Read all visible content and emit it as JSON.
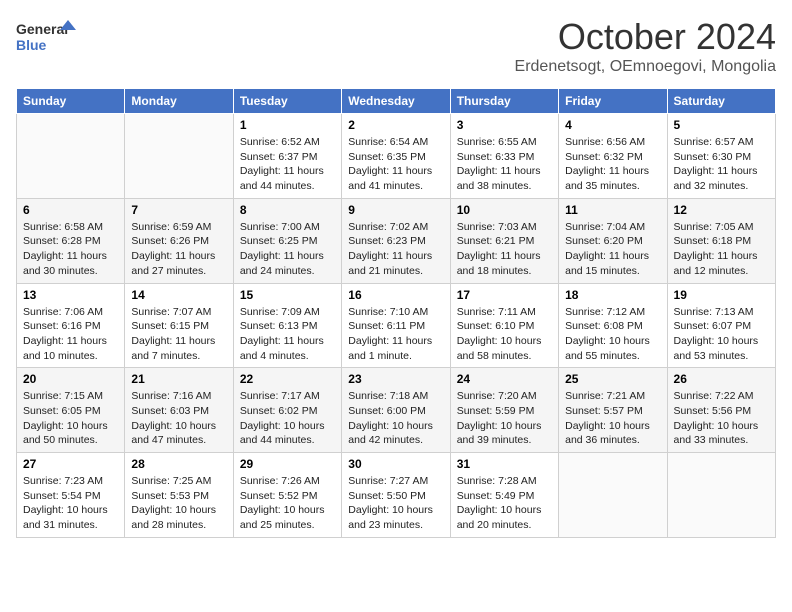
{
  "header": {
    "logo_line1": "General",
    "logo_line2": "Blue",
    "month_title": "October 2024",
    "location": "Erdenetsogt, OEmnoegovi, Mongolia"
  },
  "weekdays": [
    "Sunday",
    "Monday",
    "Tuesday",
    "Wednesday",
    "Thursday",
    "Friday",
    "Saturday"
  ],
  "weeks": [
    [
      {
        "day": "",
        "sunrise": "",
        "sunset": "",
        "daylight": ""
      },
      {
        "day": "",
        "sunrise": "",
        "sunset": "",
        "daylight": ""
      },
      {
        "day": "1",
        "sunrise": "Sunrise: 6:52 AM",
        "sunset": "Sunset: 6:37 PM",
        "daylight": "Daylight: 11 hours and 44 minutes."
      },
      {
        "day": "2",
        "sunrise": "Sunrise: 6:54 AM",
        "sunset": "Sunset: 6:35 PM",
        "daylight": "Daylight: 11 hours and 41 minutes."
      },
      {
        "day": "3",
        "sunrise": "Sunrise: 6:55 AM",
        "sunset": "Sunset: 6:33 PM",
        "daylight": "Daylight: 11 hours and 38 minutes."
      },
      {
        "day": "4",
        "sunrise": "Sunrise: 6:56 AM",
        "sunset": "Sunset: 6:32 PM",
        "daylight": "Daylight: 11 hours and 35 minutes."
      },
      {
        "day": "5",
        "sunrise": "Sunrise: 6:57 AM",
        "sunset": "Sunset: 6:30 PM",
        "daylight": "Daylight: 11 hours and 32 minutes."
      }
    ],
    [
      {
        "day": "6",
        "sunrise": "Sunrise: 6:58 AM",
        "sunset": "Sunset: 6:28 PM",
        "daylight": "Daylight: 11 hours and 30 minutes."
      },
      {
        "day": "7",
        "sunrise": "Sunrise: 6:59 AM",
        "sunset": "Sunset: 6:26 PM",
        "daylight": "Daylight: 11 hours and 27 minutes."
      },
      {
        "day": "8",
        "sunrise": "Sunrise: 7:00 AM",
        "sunset": "Sunset: 6:25 PM",
        "daylight": "Daylight: 11 hours and 24 minutes."
      },
      {
        "day": "9",
        "sunrise": "Sunrise: 7:02 AM",
        "sunset": "Sunset: 6:23 PM",
        "daylight": "Daylight: 11 hours and 21 minutes."
      },
      {
        "day": "10",
        "sunrise": "Sunrise: 7:03 AM",
        "sunset": "Sunset: 6:21 PM",
        "daylight": "Daylight: 11 hours and 18 minutes."
      },
      {
        "day": "11",
        "sunrise": "Sunrise: 7:04 AM",
        "sunset": "Sunset: 6:20 PM",
        "daylight": "Daylight: 11 hours and 15 minutes."
      },
      {
        "day": "12",
        "sunrise": "Sunrise: 7:05 AM",
        "sunset": "Sunset: 6:18 PM",
        "daylight": "Daylight: 11 hours and 12 minutes."
      }
    ],
    [
      {
        "day": "13",
        "sunrise": "Sunrise: 7:06 AM",
        "sunset": "Sunset: 6:16 PM",
        "daylight": "Daylight: 11 hours and 10 minutes."
      },
      {
        "day": "14",
        "sunrise": "Sunrise: 7:07 AM",
        "sunset": "Sunset: 6:15 PM",
        "daylight": "Daylight: 11 hours and 7 minutes."
      },
      {
        "day": "15",
        "sunrise": "Sunrise: 7:09 AM",
        "sunset": "Sunset: 6:13 PM",
        "daylight": "Daylight: 11 hours and 4 minutes."
      },
      {
        "day": "16",
        "sunrise": "Sunrise: 7:10 AM",
        "sunset": "Sunset: 6:11 PM",
        "daylight": "Daylight: 11 hours and 1 minute."
      },
      {
        "day": "17",
        "sunrise": "Sunrise: 7:11 AM",
        "sunset": "Sunset: 6:10 PM",
        "daylight": "Daylight: 10 hours and 58 minutes."
      },
      {
        "day": "18",
        "sunrise": "Sunrise: 7:12 AM",
        "sunset": "Sunset: 6:08 PM",
        "daylight": "Daylight: 10 hours and 55 minutes."
      },
      {
        "day": "19",
        "sunrise": "Sunrise: 7:13 AM",
        "sunset": "Sunset: 6:07 PM",
        "daylight": "Daylight: 10 hours and 53 minutes."
      }
    ],
    [
      {
        "day": "20",
        "sunrise": "Sunrise: 7:15 AM",
        "sunset": "Sunset: 6:05 PM",
        "daylight": "Daylight: 10 hours and 50 minutes."
      },
      {
        "day": "21",
        "sunrise": "Sunrise: 7:16 AM",
        "sunset": "Sunset: 6:03 PM",
        "daylight": "Daylight: 10 hours and 47 minutes."
      },
      {
        "day": "22",
        "sunrise": "Sunrise: 7:17 AM",
        "sunset": "Sunset: 6:02 PM",
        "daylight": "Daylight: 10 hours and 44 minutes."
      },
      {
        "day": "23",
        "sunrise": "Sunrise: 7:18 AM",
        "sunset": "Sunset: 6:00 PM",
        "daylight": "Daylight: 10 hours and 42 minutes."
      },
      {
        "day": "24",
        "sunrise": "Sunrise: 7:20 AM",
        "sunset": "Sunset: 5:59 PM",
        "daylight": "Daylight: 10 hours and 39 minutes."
      },
      {
        "day": "25",
        "sunrise": "Sunrise: 7:21 AM",
        "sunset": "Sunset: 5:57 PM",
        "daylight": "Daylight: 10 hours and 36 minutes."
      },
      {
        "day": "26",
        "sunrise": "Sunrise: 7:22 AM",
        "sunset": "Sunset: 5:56 PM",
        "daylight": "Daylight: 10 hours and 33 minutes."
      }
    ],
    [
      {
        "day": "27",
        "sunrise": "Sunrise: 7:23 AM",
        "sunset": "Sunset: 5:54 PM",
        "daylight": "Daylight: 10 hours and 31 minutes."
      },
      {
        "day": "28",
        "sunrise": "Sunrise: 7:25 AM",
        "sunset": "Sunset: 5:53 PM",
        "daylight": "Daylight: 10 hours and 28 minutes."
      },
      {
        "day": "29",
        "sunrise": "Sunrise: 7:26 AM",
        "sunset": "Sunset: 5:52 PM",
        "daylight": "Daylight: 10 hours and 25 minutes."
      },
      {
        "day": "30",
        "sunrise": "Sunrise: 7:27 AM",
        "sunset": "Sunset: 5:50 PM",
        "daylight": "Daylight: 10 hours and 23 minutes."
      },
      {
        "day": "31",
        "sunrise": "Sunrise: 7:28 AM",
        "sunset": "Sunset: 5:49 PM",
        "daylight": "Daylight: 10 hours and 20 minutes."
      },
      {
        "day": "",
        "sunrise": "",
        "sunset": "",
        "daylight": ""
      },
      {
        "day": "",
        "sunrise": "",
        "sunset": "",
        "daylight": ""
      }
    ]
  ]
}
